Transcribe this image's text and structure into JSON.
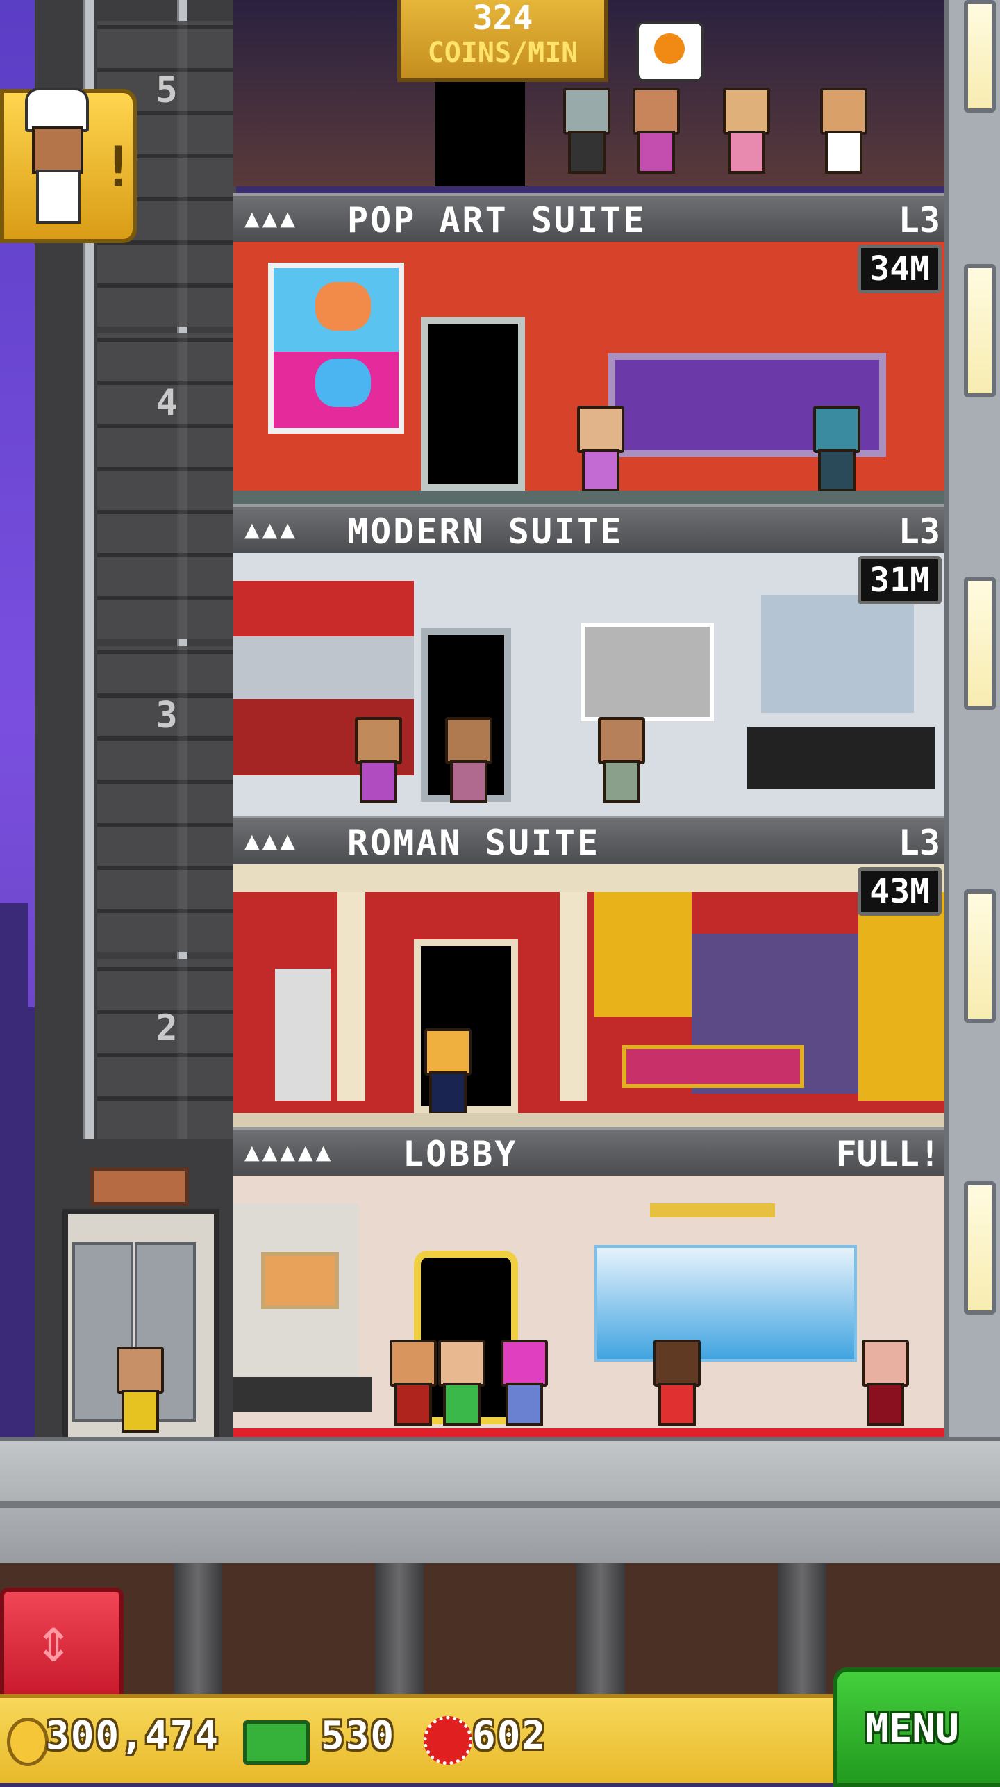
{
  "top_banner": {
    "rate_value": "324",
    "rate_unit": "COINS/MIN"
  },
  "floors": [
    {
      "people": "▲▲▲",
      "name": "POP ART SUITE",
      "level": "L3",
      "timer": "34M"
    },
    {
      "people": "▲▲▲",
      "name": "MODERN SUITE",
      "level": "L3",
      "timer": "31M"
    },
    {
      "people": "▲▲▲",
      "name": "ROMAN SUITE",
      "level": "L3",
      "timer": "43M"
    },
    {
      "people": "▲▲▲▲▲",
      "name": "LOBBY",
      "level": "FULL!"
    }
  ],
  "elevator": {
    "floor_numbers": [
      "5",
      "4",
      "3",
      "2"
    ]
  },
  "hud": {
    "coins": "300,474",
    "bux": "530",
    "gems": "602",
    "menu_label": "MENU"
  },
  "icons": {
    "coin": "coin-icon",
    "bux": "tower-bux-icon",
    "gem": "gem-icon",
    "elevator_arrows": "up-down-arrows-icon",
    "chef": "chef-notification-icon"
  },
  "colors": {
    "hud_bg": "#e8b92b",
    "menu_green": "#2fb52a",
    "elevator_red": "#d82838",
    "floor_bar": "#5b5c60"
  }
}
